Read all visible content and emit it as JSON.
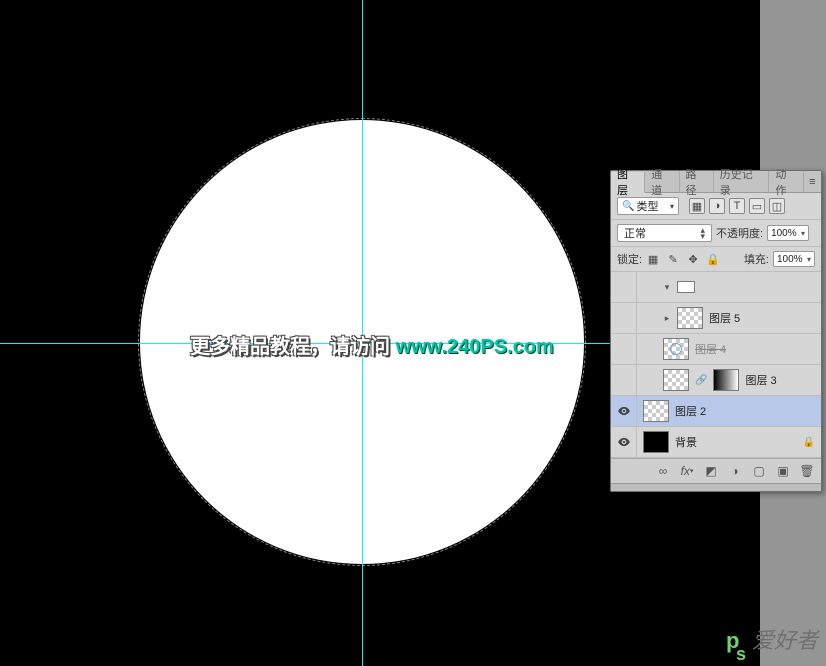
{
  "overlay": {
    "text_main": "更多精品教程，请访问 ",
    "url": "www.240PS.com"
  },
  "panel": {
    "tabs": {
      "layers": "图层",
      "channels": "通道",
      "paths": "路径",
      "history": "历史记录",
      "actions": "动作"
    },
    "filter": {
      "kind": "类型"
    },
    "blend": {
      "mode": "正常",
      "opacity_label": "不透明度:",
      "opacity_value": "100%"
    },
    "lock": {
      "label": "锁定:",
      "fill_label": "填充:",
      "fill_value": "100%"
    },
    "layers": {
      "l5": "图层 5",
      "l4": "图层 4",
      "l3": "图层 3",
      "l2": "图层 2",
      "bg": "背景"
    }
  },
  "watermark": {
    "ps": "ps",
    "text": "爱好者"
  }
}
